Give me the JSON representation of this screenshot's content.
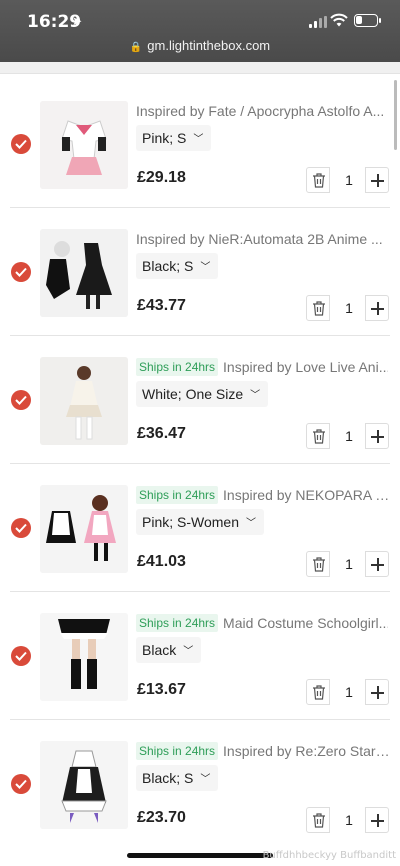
{
  "status_bar": {
    "time": "16:29",
    "url": "gm.lightinthebox.com"
  },
  "cart": {
    "items": [
      {
        "title": "Inspired by Fate / Apocrypha Astolfo A...",
        "badge": "",
        "variant": "Pink; S",
        "price": "£29.18",
        "qty": "1"
      },
      {
        "title": "Inspired by NieR:Automata 2B Anime ...",
        "badge": "",
        "variant": "Black; S",
        "price": "£43.77",
        "qty": "1"
      },
      {
        "title": "Inspired by Love Live Ani...",
        "badge": "Ships in 24hrs",
        "variant": "White; One Size",
        "price": "£36.47",
        "qty": "1"
      },
      {
        "title": "Inspired by NEKOPARA c...",
        "badge": "Ships in 24hrs",
        "variant": "Pink; S-Women",
        "price": "£41.03",
        "qty": "1"
      },
      {
        "title": "Maid Costume Schoolgirl...",
        "badge": "Ships in 24hrs",
        "variant": "Black",
        "price": "£13.67",
        "qty": "1"
      },
      {
        "title": "Inspired by Re:Zero Starti...",
        "badge": "Ships in 24hrs",
        "variant": "Black; S",
        "price": "£23.70",
        "qty": "1"
      }
    ]
  },
  "watermark": "Buffdhhbeckyy Buffbanditt",
  "colors": {
    "accent": "#d94a3a",
    "ships_badge_text": "#2e9e58",
    "ships_badge_bg": "#e9f6ee"
  }
}
